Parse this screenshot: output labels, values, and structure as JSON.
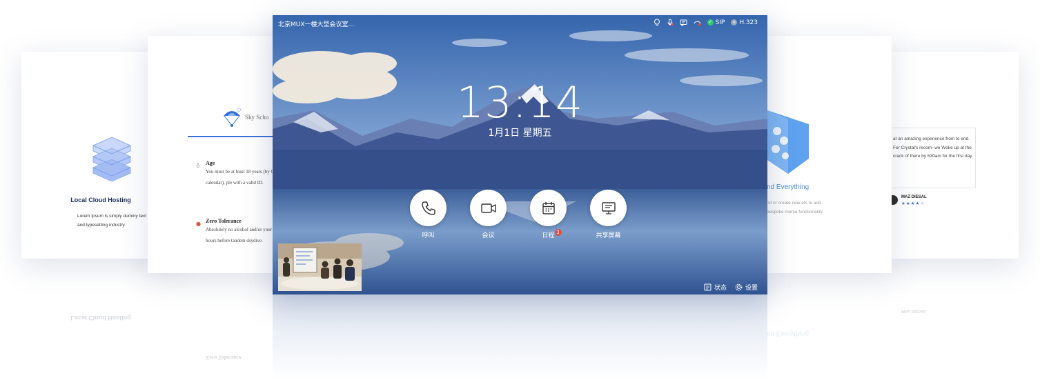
{
  "far_left_card": {
    "title": "Local Cloud Hosting",
    "body": "Lorem Ipsum is simply dummy text of the printing and typesetting industry."
  },
  "near_left_card": {
    "brand": "Sky Scho",
    "sections": [
      {
        "title": "Age",
        "text": "You must be at least 18 years (by Gregorian calendar), ple with a valid ID."
      },
      {
        "title": "Zero Tolerance",
        "text": "Absolutely no alcohol and/or your system 24 hours before tandem skydive."
      }
    ]
  },
  "near_right_card": {
    "title": "nd Everything",
    "body": "nd or create new ets to add bespoke merce functionality."
  },
  "far_right_card": {
    "quote": "at an amazing experience from to end. Fer Crystal's recom- we Woke up at the crack of there by 630am for the first day.",
    "author": "MAZ DIESAL",
    "rating_filled": "★★★★",
    "rating_empty": "★",
    "rating": 4
  },
  "screen": {
    "room_name": "北京MUX一楼大型会议室...",
    "status": {
      "sip_label": "SIP",
      "h323_label": "H.323",
      "sip_color": "#2ecc71",
      "h323_color": "#9aa5b8"
    },
    "time": "13:14",
    "date": "1月1日  星期五",
    "actions": [
      {
        "label": "呼叫",
        "icon": "phone-icon"
      },
      {
        "label": "会议",
        "icon": "video-camera-icon"
      },
      {
        "label": "日程",
        "icon": "calendar-icon",
        "badge": "3"
      },
      {
        "label": "共享屏幕",
        "icon": "screen-share-icon"
      }
    ],
    "footer": {
      "status_label": "状态",
      "settings_label": "设置"
    }
  }
}
